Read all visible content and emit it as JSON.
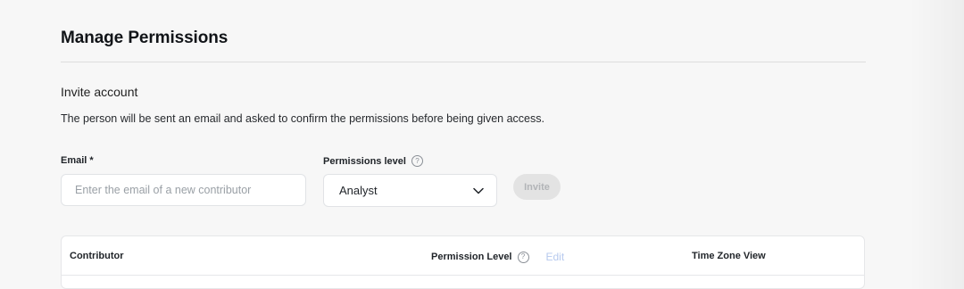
{
  "page": {
    "title": "Manage Permissions"
  },
  "invite": {
    "heading": "Invite account",
    "description": "The person will be sent an email and asked to confirm the permissions before being given access.",
    "email_label": "Email *",
    "email_placeholder": "Enter the email of a new contributor",
    "email_value": "",
    "permissions_label": "Permissions level",
    "permissions_selected": "Analyst",
    "invite_button_label": "Invite"
  },
  "table": {
    "columns": {
      "contributor": "Contributor",
      "permission_level": "Permission Level",
      "edit_label": "Edit",
      "time_zone_view": "Time Zone View"
    }
  },
  "icons": {
    "help": "help-circle-icon",
    "dropdown": "chevron-down-icon"
  },
  "colors": {
    "background": "#f7f7f7",
    "edit_link": "#b6c9ee",
    "invite_disabled_bg": "#e3e3e3",
    "invite_disabled_text": "#b2b4b7"
  }
}
